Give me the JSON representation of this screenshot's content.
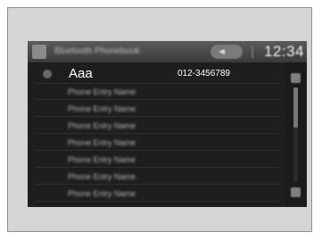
{
  "header": {
    "title": "Bluetooth Phonebook",
    "clock": "12:34"
  },
  "contacts": {
    "selected": {
      "name": "Aaa",
      "number": "012-3456789"
    },
    "entries": [
      "Phone Entry Name",
      "Phone Entry Name",
      "Phone Entry Name",
      "Phone Entry Name",
      "Phone Entry Name",
      "Phone Entry Name",
      "Phone Entry Name"
    ]
  },
  "scrollbar": {
    "position_fraction": 0.0,
    "visible_fraction": 0.42
  },
  "icons": {
    "back": "back-icon",
    "list_item": "contact-dot-icon",
    "scroll_up": "scroll-up-icon",
    "scroll_down": "scroll-down-icon"
  }
}
